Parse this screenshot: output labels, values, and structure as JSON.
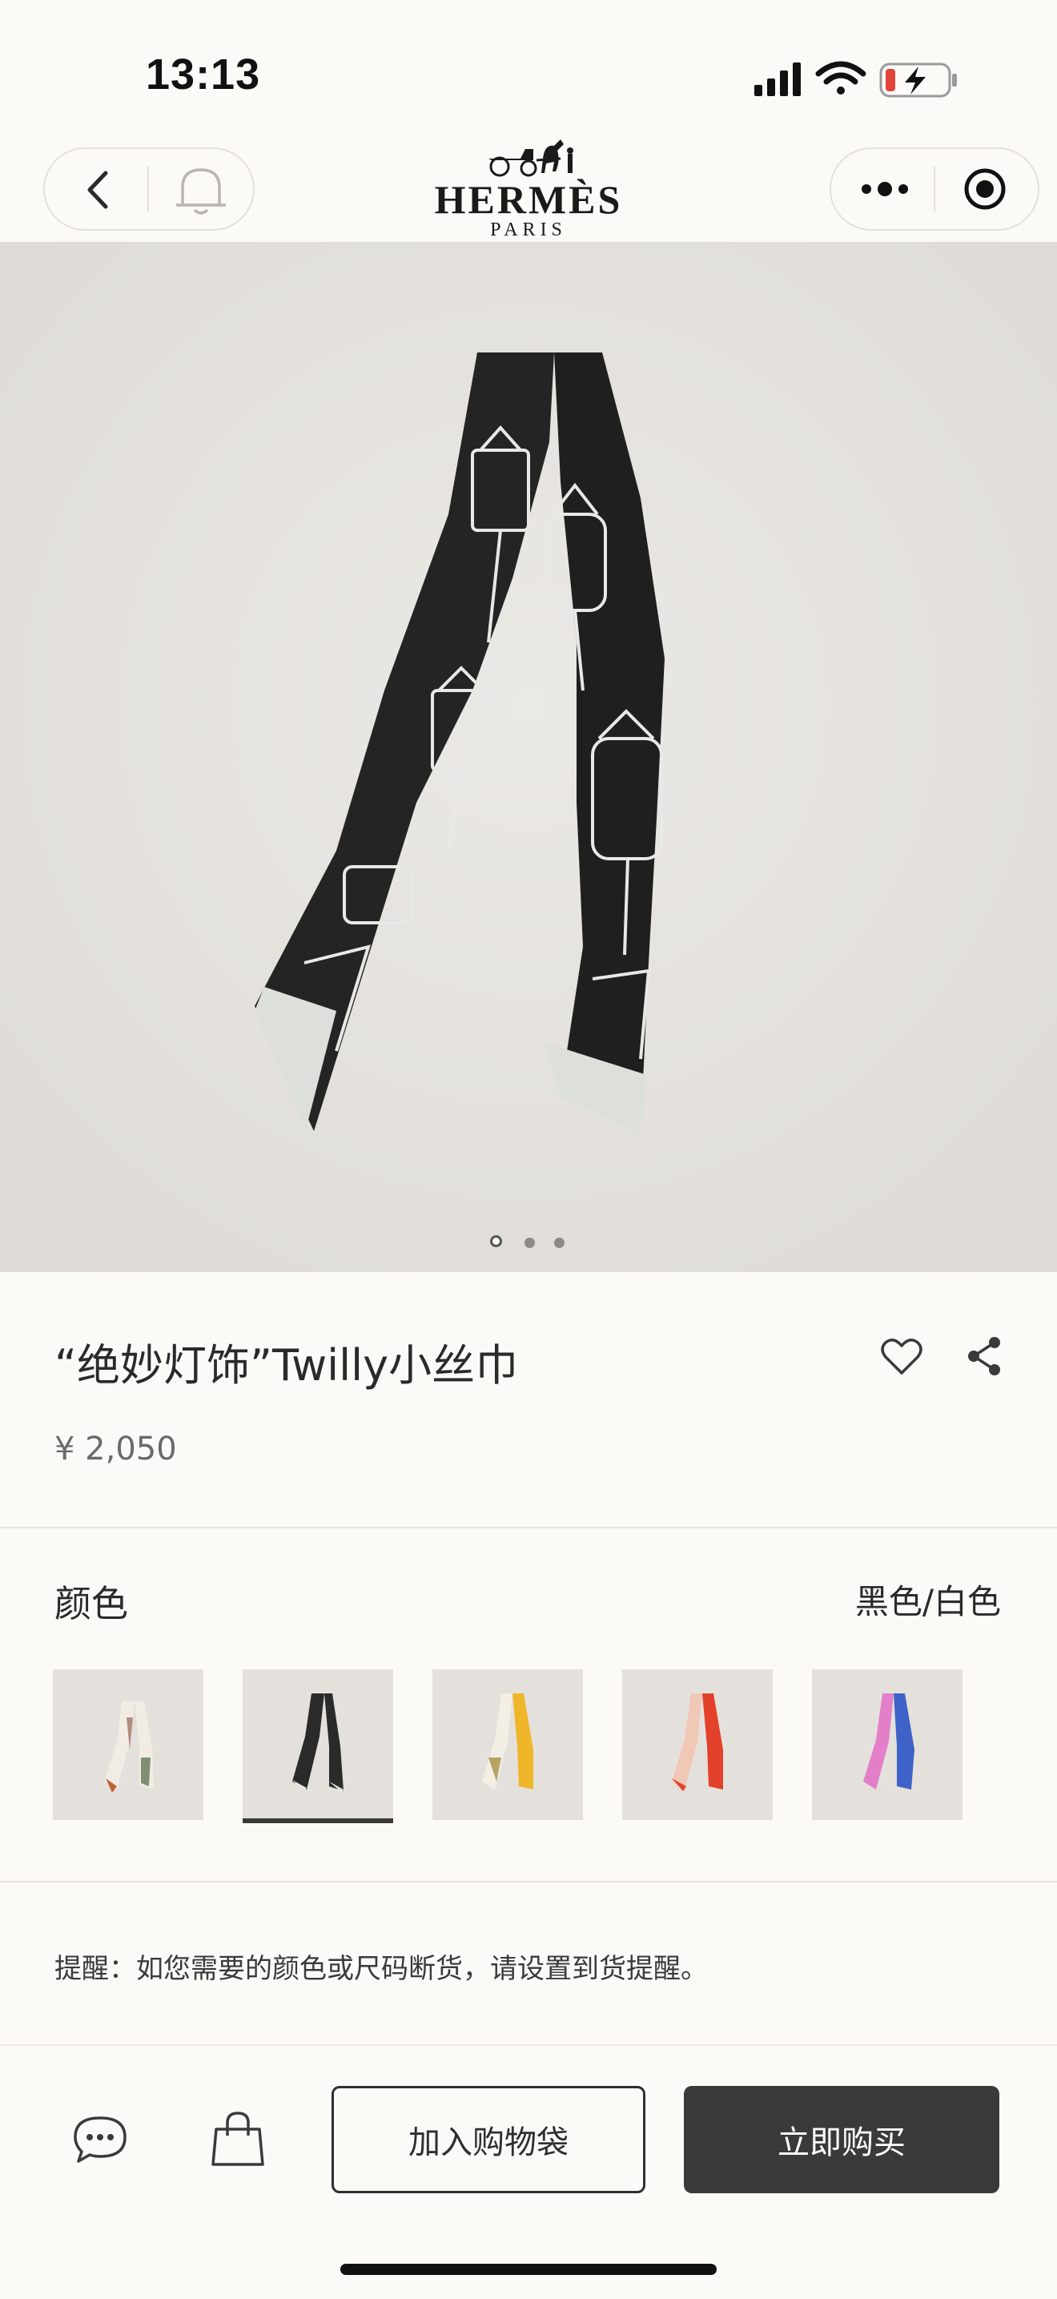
{
  "status_bar": {
    "time": "13:13"
  },
  "header": {
    "brand_name": "HERMÈS",
    "brand_city": "PARIS"
  },
  "product": {
    "title": "“绝妙灯饰”Twilly小丝巾",
    "price": "¥ 2,050",
    "image_count": 3,
    "current_image": 1
  },
  "color_section": {
    "label": "颜色",
    "selected_value": "黑色/白色",
    "swatches": [
      {
        "name": "ivory-green",
        "base": "#f1ede4",
        "accent": "#7f8f74",
        "selected": false
      },
      {
        "name": "black-white",
        "base": "#2a2a2a",
        "accent": "#e8e6e2",
        "selected": true
      },
      {
        "name": "white-yellow",
        "base": "#f3efe4",
        "accent": "#f0b62a",
        "selected": false
      },
      {
        "name": "pink-red",
        "base": "#f1c7b6",
        "accent": "#e4412a",
        "selected": false
      },
      {
        "name": "pink-blue",
        "base": "#e37fc9",
        "accent": "#3f62c8",
        "selected": false
      }
    ]
  },
  "notice": "提醒：如您需要的颜色或尺码断货，请设置到货提醒。",
  "actions": {
    "add_to_bag": "加入购物袋",
    "buy_now": "立即购买"
  },
  "icons": [
    "back-icon",
    "bell-icon",
    "more-icon",
    "target-icon",
    "heart-icon",
    "share-icon",
    "chat-icon",
    "bag-icon"
  ]
}
